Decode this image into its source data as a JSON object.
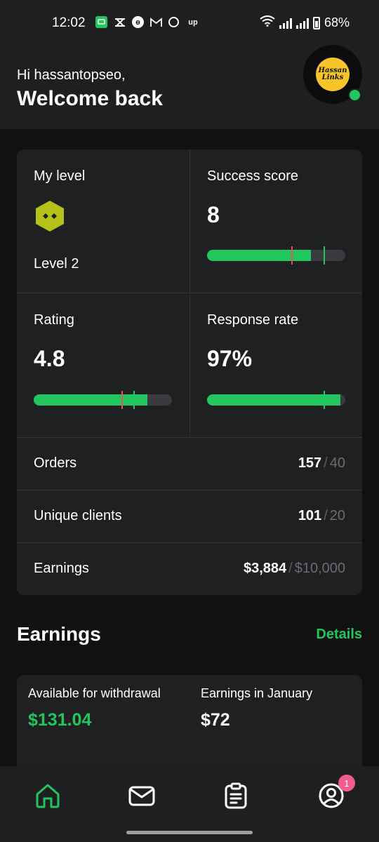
{
  "status_bar": {
    "time": "12:02",
    "battery": "68%",
    "icons": [
      "chat-icon",
      "capcut-icon",
      "threads-icon",
      "gmail-icon",
      "circle-icon",
      "upwork-icon",
      "wifi-icon",
      "signal-icon",
      "signal-icon",
      "battery-icon"
    ]
  },
  "header": {
    "greeting": "Hi hassantopseo,",
    "welcome": "Welcome back",
    "avatar_text_line1": "Hassan",
    "avatar_text_line2": "Links",
    "online": true
  },
  "stats": {
    "level": {
      "label": "My level",
      "value": "Level 2"
    },
    "success_score": {
      "label": "Success score",
      "value": "8"
    },
    "rating": {
      "label": "Rating",
      "value": "4.8"
    },
    "response_rate": {
      "label": "Response rate",
      "value": "97%"
    },
    "rows": [
      {
        "label": "Orders",
        "value": "157",
        "target": "40"
      },
      {
        "label": "Unique clients",
        "value": "101",
        "target": "20"
      },
      {
        "label": "Earnings",
        "value": "$3,884",
        "target": "$10,000"
      }
    ],
    "separator": "/"
  },
  "earnings": {
    "title": "Earnings",
    "details_link": "Details",
    "available_label": "Available for withdrawal",
    "available_value": "$131.04",
    "month_label": "Earnings in January",
    "month_value": "$72"
  },
  "nav": {
    "items": [
      "home-icon",
      "inbox-icon",
      "orders-icon",
      "profile-icon"
    ],
    "profile_badge": "1"
  },
  "colors": {
    "accent": "#22c55e",
    "warning_marker": "#ef5350",
    "badge": "#f25c8a",
    "level_badge": "#b5c21a"
  }
}
